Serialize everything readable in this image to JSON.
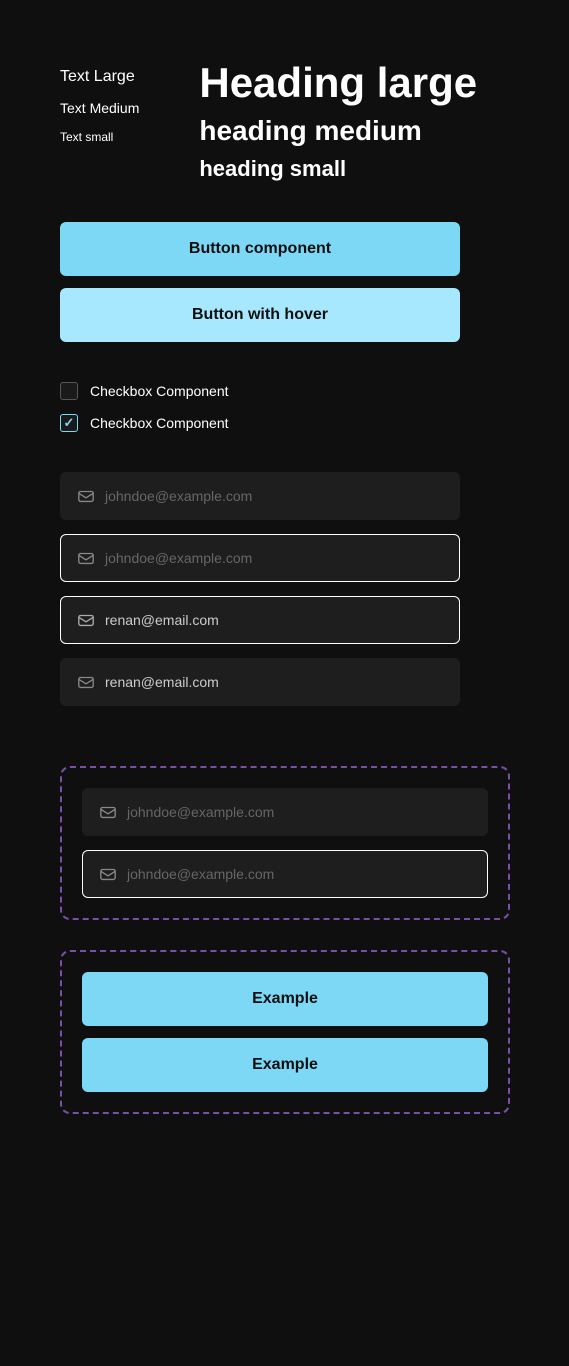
{
  "typography": {
    "text_large": "Text Large",
    "text_medium": "Text Medium",
    "text_small": "Text small",
    "heading_large": "Heading large",
    "heading_medium": "heading medium",
    "heading_small": "heading small"
  },
  "buttons": {
    "component_label": "Button component",
    "hover_label": "Button with hover"
  },
  "checkboxes": [
    {
      "label": "Checkbox Component",
      "checked": false
    },
    {
      "label": "Checkbox Component",
      "checked": true
    }
  ],
  "inputs": [
    {
      "placeholder": "johndoe@example.com",
      "value": "",
      "focused": false
    },
    {
      "placeholder": "johndoe@example.com",
      "value": "",
      "focused": true
    },
    {
      "placeholder": "",
      "value": "renan@email.com",
      "focused": true
    },
    {
      "placeholder": "",
      "value": "renan@email.com",
      "focused": false
    }
  ],
  "group_inputs": [
    {
      "placeholder": "johndoe@example.com",
      "value": "",
      "focused": false
    },
    {
      "placeholder": "johndoe@example.com",
      "value": "",
      "focused": true
    }
  ],
  "group_buttons": [
    {
      "label": "Example"
    },
    {
      "label": "Example"
    }
  ]
}
